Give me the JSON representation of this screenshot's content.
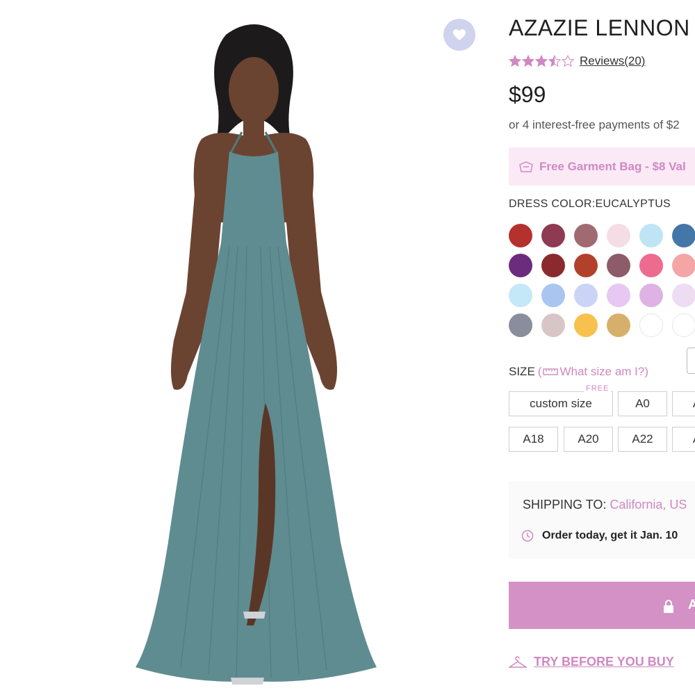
{
  "product": {
    "title": "AZAZIE LENNON",
    "rating": 3.5,
    "rating_max": 5,
    "reviews_label": "Reviews(20)",
    "price": "$99",
    "installments": "or 4 interest-free payments of $2"
  },
  "promo": {
    "text": "Free Garment Bag - $8 Val",
    "icon": "garment-bag-icon"
  },
  "color": {
    "label": "DRESS COLOR:EUCALYPTUS",
    "swatches": [
      "#b5312e",
      "#8e3a52",
      "#a06a70",
      "#f5dde6",
      "#bfe5f5",
      "#4476a8",
      "#6b2c7e",
      "#8b2a2e",
      "#b2412c",
      "#8d5b69",
      "#ee6b90",
      "#f4a6a6",
      "#c4e8f8",
      "#a8c6ef",
      "#cbd4f6",
      "#e6c8f2",
      "#dfb2e6",
      "#eedcf2",
      "#8a8d9c",
      "#d8c6c6",
      "#f8c14e",
      "#d6b06b",
      "#ffffff",
      "#ffffff"
    ]
  },
  "size": {
    "label": "SIZE",
    "help": "What size am I?",
    "free_tag": "FREE",
    "options": [
      "custom size",
      "A0",
      "A",
      "A18",
      "A20",
      "A22",
      "A"
    ]
  },
  "shipping": {
    "label": "SHIPPING TO: ",
    "location": "California, US",
    "delivery": "Order today,  get it Jan. 10"
  },
  "cart": {
    "label": "A"
  },
  "try": {
    "label": "TRY BEFORE YOU BUY"
  },
  "colors": {
    "accent": "#d088c2",
    "button": "#d391c6",
    "dress": "#5f8c90"
  }
}
